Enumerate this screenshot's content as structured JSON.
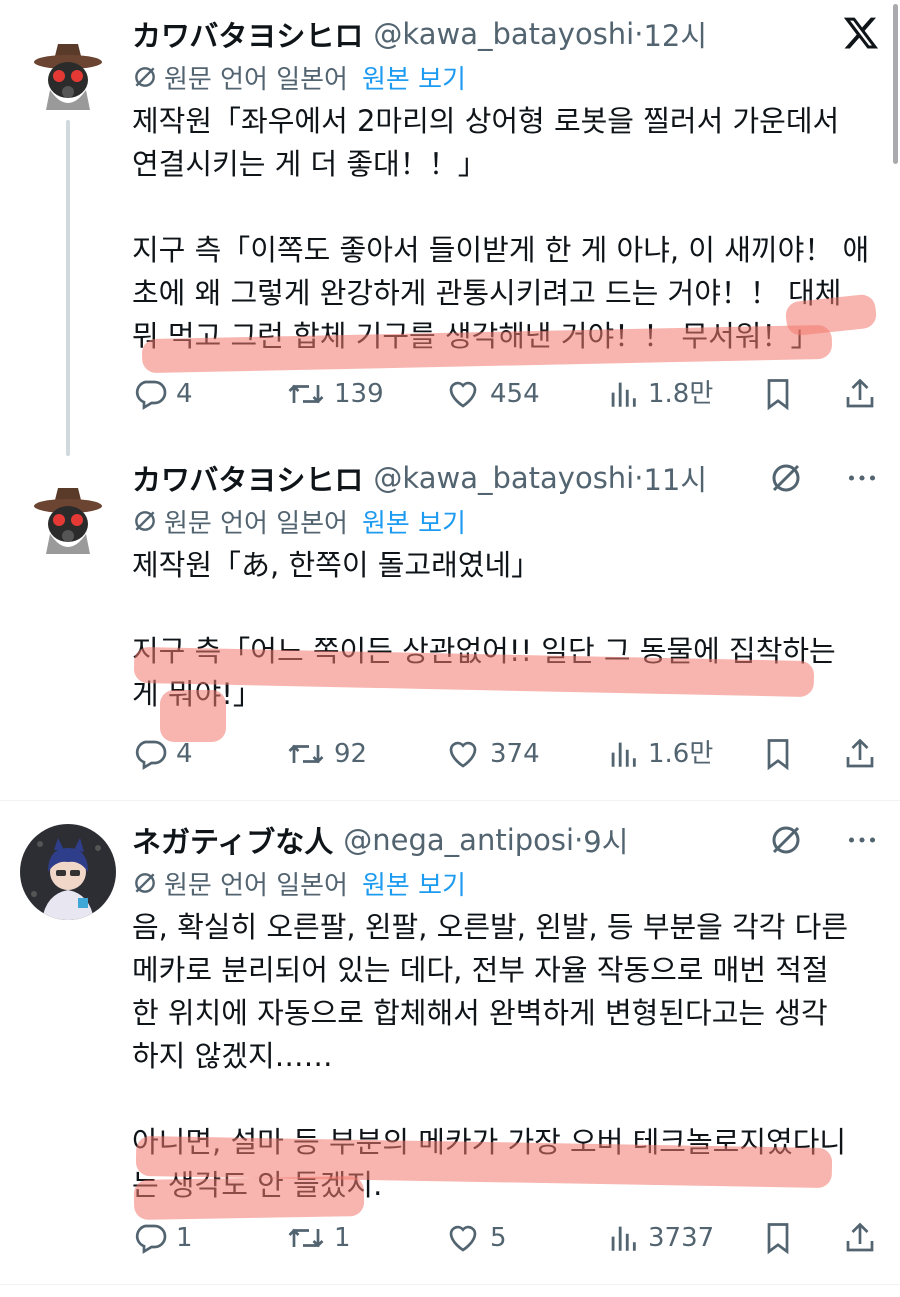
{
  "translate": {
    "label": "원문 언어 일본어",
    "link": "원본 보기"
  },
  "tweets": [
    {
      "name": "カワバタヨシヒロ",
      "handle": "@kawa_batayoshi",
      "sep": "·",
      "time": "12시",
      "text": "제작원「좌우에서 2마리의 상어형 로봇을 찔러서 가운데서\n연결시키는 게 더 좋대！！」\n\n지구 측「이쪽도 좋아서 들이받게 한 게 아냐, 이 새끼야！ 애\n초에 왜 그렇게 완강하게 관통시키려고 드는 거야！！ 대체\n뭐 먹고 그런 합체 기구를 생각해낸 거야！！ 무서워！」",
      "replies": "4",
      "retweets": "139",
      "likes": "454",
      "views": "1.8만"
    },
    {
      "name": "カワバタヨシヒロ",
      "handle": "@kawa_batayoshi",
      "sep": "·",
      "time": "11시",
      "text": "제작원「あ, 한쪽이 돌고래였네」\n\n지구 측「어느 쪽이든 상관없어!! 일단 그 동물에 집착하는\n게 뭐야!」",
      "replies": "4",
      "retweets": "92",
      "likes": "374",
      "views": "1.6만"
    },
    {
      "name": "ネガティブな人",
      "handle": "@nega_antiposi",
      "sep": "·",
      "time": "9시",
      "text": "음, 확실히 오른팔, 왼팔, 오른발, 왼발, 등 부분을 각각 다른\n메카로 분리되어 있는 데다, 전부 자율 작동으로 매번 적절\n한 위치에 자동으로 합체해서 완벽하게 변형된다고는 생각\n하지 않겠지……\n\n아니면, 설마 등 부분의 메카가 가장 오버 테크놀로지였다니\n는 생각도 안 들겠지.",
      "replies": "1",
      "retweets": "1",
      "likes": "5",
      "views": "3737"
    }
  ],
  "colors": {
    "secondary": "#536471",
    "link": "#1d9bf0",
    "text": "#0f1419",
    "highlight": "#f2786e"
  },
  "icons": [
    "x-logo-icon",
    "translate-icon",
    "grok-icon",
    "more-icon",
    "reply-icon",
    "retweet-icon",
    "like-icon",
    "views-icon",
    "bookmark-icon",
    "share-icon"
  ]
}
